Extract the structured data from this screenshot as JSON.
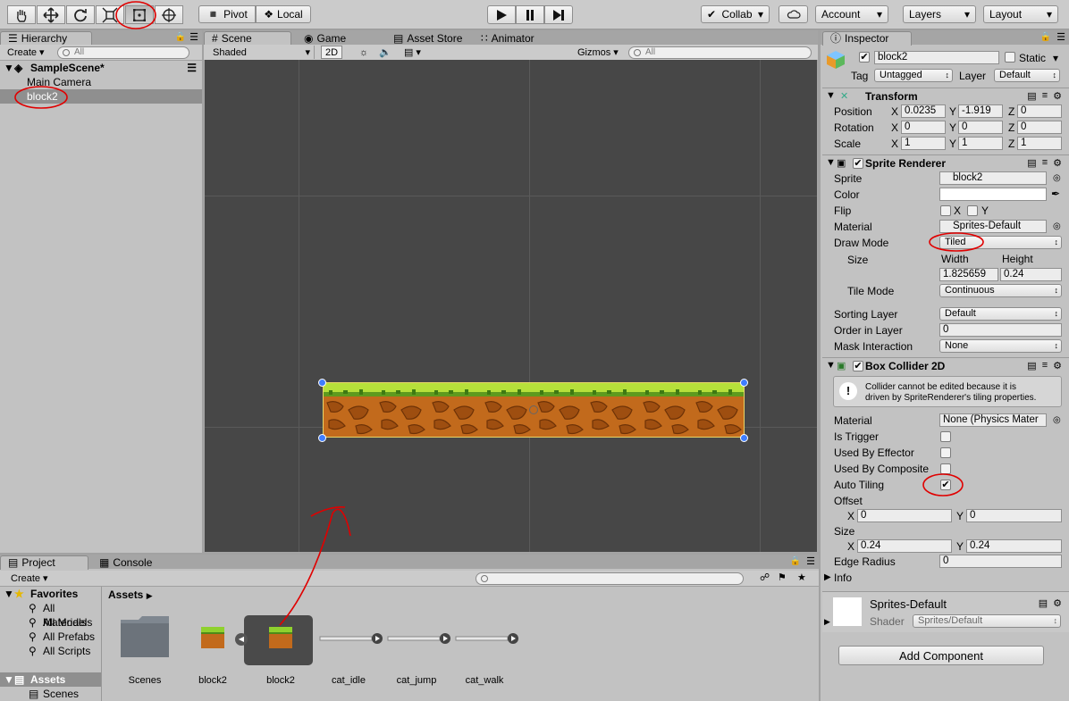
{
  "toolbar": {
    "pivot": "Pivot",
    "local": "Local",
    "collab": "Collab",
    "account": "Account",
    "layers": "Layers",
    "layout": "Layout"
  },
  "hierarchy": {
    "tab": "Hierarchy",
    "create": "Create",
    "search_placeholder": "All",
    "scene": "SampleScene*",
    "items": [
      "Main Camera",
      "block2"
    ]
  },
  "scene_tabs": [
    "Scene",
    "Game",
    "Asset Store",
    "Animator"
  ],
  "scene_bar": {
    "shading": "Shaded",
    "mode2d": "2D",
    "gizmos": "Gizmos",
    "search_placeholder": "All"
  },
  "inspector": {
    "tab": "Inspector",
    "object_name": "block2",
    "static_label": "Static",
    "tag_label": "Tag",
    "tag_value": "Untagged",
    "layer_label": "Layer",
    "layer_value": "Default",
    "transform": {
      "title": "Transform",
      "rows": [
        {
          "label": "Position",
          "x": "0.0235",
          "y": "-1.919",
          "z": "0"
        },
        {
          "label": "Rotation",
          "x": "0",
          "y": "0",
          "z": "0"
        },
        {
          "label": "Scale",
          "x": "1",
          "y": "1",
          "z": "1"
        }
      ]
    },
    "sprite_renderer": {
      "title": "Sprite Renderer",
      "sprite_label": "Sprite",
      "sprite_value": "block2",
      "color_label": "Color",
      "flip_label": "Flip",
      "flip_x": "X",
      "flip_y": "Y",
      "material_label": "Material",
      "material_value": "Sprites-Default",
      "draw_mode_label": "Draw Mode",
      "draw_mode_value": "Tiled",
      "size_label": "Size",
      "width_label": "Width",
      "height_label": "Height",
      "width_value": "1.825659",
      "height_value": "0.24",
      "tile_mode_label": "Tile Mode",
      "tile_mode_value": "Continuous",
      "sorting_layer_label": "Sorting Layer",
      "sorting_layer_value": "Default",
      "order_label": "Order in Layer",
      "order_value": "0",
      "mask_label": "Mask Interaction",
      "mask_value": "None"
    },
    "box_collider": {
      "title": "Box Collider 2D",
      "info_line1": "Collider cannot be edited because it is",
      "info_line2": "driven by SpriteRenderer's tiling properties.",
      "material_label": "Material",
      "material_value": "None (Physics Mater",
      "is_trigger": "Is Trigger",
      "used_by_effector": "Used By Effector",
      "used_by_composite": "Used By Composite",
      "auto_tiling": "Auto Tiling",
      "offset_label": "Offset",
      "offset_x": "0",
      "offset_y": "0",
      "size_label": "Size",
      "size_x": "0.24",
      "size_y": "0.24",
      "edge_radius_label": "Edge Radius",
      "edge_radius_value": "0",
      "info_label": "Info",
      "x": "X",
      "y": "Y"
    },
    "material_preview": {
      "name": "Sprites-Default",
      "shader_label": "Shader",
      "shader_value": "Sprites/Default"
    },
    "add_component": "Add Component"
  },
  "project": {
    "tabs": [
      "Project",
      "Console"
    ],
    "create": "Create",
    "favorites_title": "Favorites",
    "favorites": [
      "All Materials",
      "All Models",
      "All Prefabs",
      "All Scripts"
    ],
    "assets_title": "Assets",
    "assets_children": [
      "Scenes"
    ],
    "breadcrumb": "Assets",
    "items": [
      "Scenes",
      "block2",
      "block2",
      "cat_idle",
      "cat_jump",
      "cat_walk"
    ]
  },
  "colors": {
    "annotation": "#e00000",
    "selection": "#8f8f8f",
    "scene_bg": "#474747"
  }
}
